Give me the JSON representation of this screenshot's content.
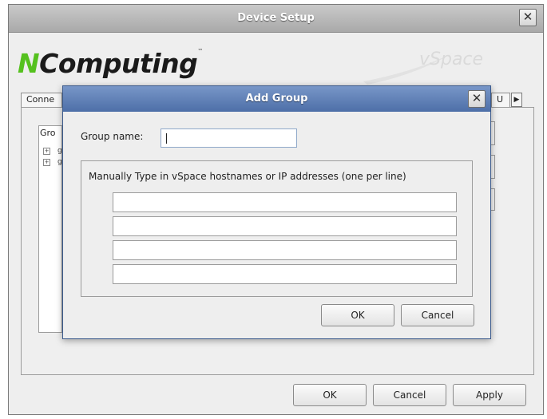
{
  "window": {
    "title": "Device Setup",
    "close_glyph": "✕"
  },
  "logo": {
    "letter": "N",
    "rest": "Computing",
    "tm": "™",
    "watermark": "vSpace"
  },
  "tabs": {
    "left_label": "Conne",
    "right_label": "U",
    "arrow_glyph": "▶"
  },
  "groups_panel": {
    "header": "Gro",
    "tree_items": [
      "g",
      "g"
    ],
    "expander_glyph": "+"
  },
  "footer": {
    "ok_label": "OK",
    "cancel_label": "Cancel",
    "apply_label": "Apply"
  },
  "dialog": {
    "title": "Add Group",
    "close_glyph": "✕",
    "group_name_label": "Group name:",
    "group_name_value": "",
    "hosts_label": "Manually Type in vSpace hostnames or IP addresses (one per line)",
    "host_lines": [
      "",
      "",
      "",
      ""
    ],
    "ok_label": "OK",
    "cancel_label": "Cancel"
  },
  "colors": {
    "dialog_title": "#5a7ab2",
    "brand_green": "#55c11e"
  }
}
